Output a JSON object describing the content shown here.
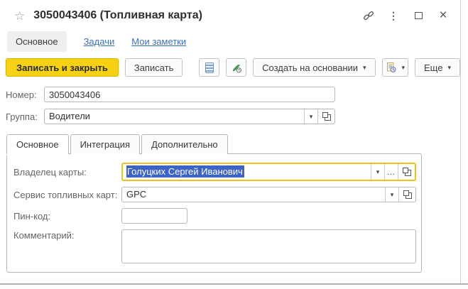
{
  "window": {
    "title": "3050043406 (Топливная карта)"
  },
  "icons": {
    "star": "☆",
    "more_vertical": "⋮",
    "close": "×",
    "dropdown_arrow": "▾",
    "ellipsis": "…"
  },
  "nav": {
    "items": [
      {
        "label": "Основное",
        "active": true
      },
      {
        "label": "Задачи",
        "active": false
      },
      {
        "label": "Мои заметки",
        "active": false
      }
    ]
  },
  "toolbar": {
    "save_and_close": "Записать и закрыть",
    "save": "Записать",
    "create_based_on": "Создать на основании",
    "more": "Еще"
  },
  "form": {
    "number": {
      "label": "Номер:",
      "value": "3050043406"
    },
    "group": {
      "label": "Группа:",
      "value": "Водители"
    }
  },
  "tabs": {
    "items": [
      {
        "label": "Основное",
        "active": true
      },
      {
        "label": "Интеграция",
        "active": false
      },
      {
        "label": "Дополнительно",
        "active": false
      }
    ]
  },
  "panel": {
    "card_owner": {
      "label": "Владелец карты:",
      "value": "Голуцких Сергей Иванович"
    },
    "fuel_card_service": {
      "label": "Сервис топливных карт:",
      "value": "GPC"
    },
    "pin_code": {
      "label": "Пин-код:",
      "value": ""
    },
    "comment": {
      "label": "Комментарий:",
      "value": ""
    }
  },
  "colors": {
    "primary_button_bg": "#f7d213",
    "primary_button_border": "#d9b501",
    "focus_border": "#efc11b",
    "selection_bg": "#3b63c8",
    "link": "#3d71bc"
  }
}
